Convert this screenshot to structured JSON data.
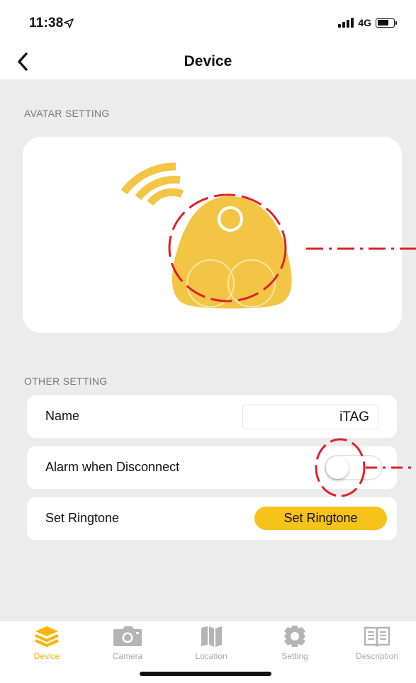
{
  "status_bar": {
    "time": "11:38",
    "network": "4G"
  },
  "header": {
    "title": "Device"
  },
  "avatar_section": {
    "title": "AVATAR SETTING"
  },
  "other_section": {
    "title": "OTHER SETTING",
    "name_row": {
      "label": "Name",
      "value": "iTAG"
    },
    "alarm_row": {
      "label": "Alarm when Disconnect",
      "toggle_on": false
    },
    "ringtone_row": {
      "label": "Set Ringtone",
      "button_label": "Set Ringtone"
    }
  },
  "tab_bar": {
    "tabs": [
      {
        "label": "Device",
        "icon": "layers-icon",
        "active": true
      },
      {
        "label": "Camera",
        "icon": "camera-icon",
        "active": false
      },
      {
        "label": "Location",
        "icon": "map-icon",
        "active": false
      },
      {
        "label": "Setting",
        "icon": "gear-icon",
        "active": false
      },
      {
        "label": "Description",
        "icon": "book-icon",
        "active": false
      }
    ]
  },
  "colors": {
    "accent": "#f7b500",
    "tag_yellow": "#f3c544",
    "annotation_red": "#e0202a",
    "background": "#ececec",
    "inactive": "#a9a9a9"
  }
}
